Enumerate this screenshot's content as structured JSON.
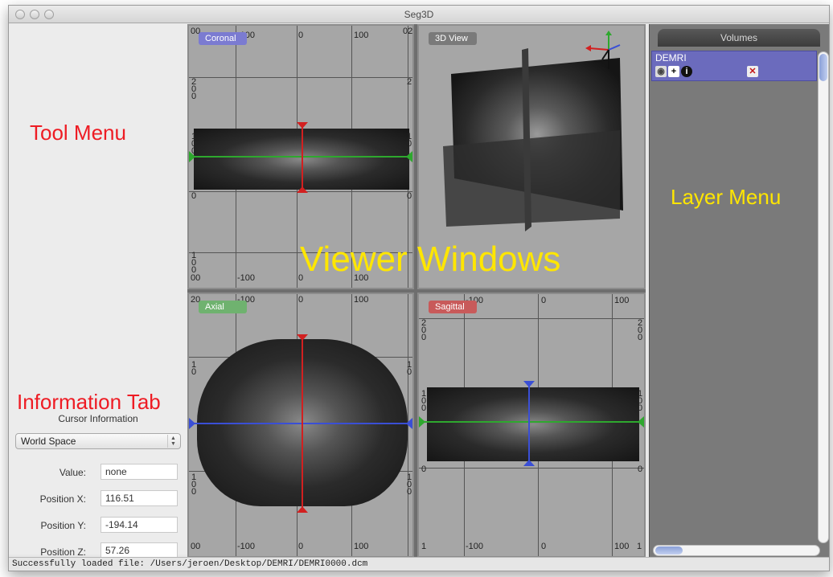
{
  "window": {
    "title": "Seg3D"
  },
  "annotations": {
    "tool_menu": "Tool Menu",
    "information_tab": "Information Tab",
    "layer_menu": "Layer Menu",
    "viewer_windows": "Viewer Windows"
  },
  "cursor_info": {
    "title": "Cursor Information",
    "space": "World Space",
    "fields": [
      {
        "label": "Value:",
        "value": "none"
      },
      {
        "label": "Position X:",
        "value": "116.51"
      },
      {
        "label": "Position Y:",
        "value": "-194.14"
      },
      {
        "label": "Position Z:",
        "value": "57.26"
      }
    ]
  },
  "viewers": {
    "coronal": {
      "label": "Coronal",
      "ticks_top": [
        "00",
        "-100",
        "0",
        "100",
        "02"
      ],
      "ticks_bottom": [
        "00",
        "-100",
        "0",
        "100"
      ],
      "ticks_left": [
        "200",
        "100",
        "0",
        "100"
      ],
      "ticks_right": [
        "2",
        "10",
        "0"
      ]
    },
    "view3d": {
      "label": "3D View"
    },
    "axial": {
      "label": "Axial",
      "ticks_top": [
        "20",
        "-100",
        "0",
        "100"
      ],
      "ticks_bottom": [
        "00",
        "-100",
        "0",
        "100"
      ],
      "ticks_left": [
        "10",
        "100"
      ],
      "ticks_right": [
        "10",
        "100"
      ]
    },
    "sagittal": {
      "label": "Sagittal",
      "ticks_top": [
        "-100",
        "0",
        "100"
      ],
      "ticks_bottom": [
        "1",
        "-100",
        "0",
        "100",
        "1"
      ],
      "ticks_left": [
        "200",
        "100",
        "0"
      ],
      "ticks_right": [
        "200",
        "100",
        "0"
      ]
    }
  },
  "colors": {
    "coronal_label": "#7b7bd1",
    "view3d_label": "#7a7a7a",
    "axial_label": "#6fb26f",
    "sagittal_label": "#c85a5a",
    "red_line": "#d22020",
    "green_line": "#2ea82e",
    "blue_line": "#3a4fd6"
  },
  "layers": {
    "tab": "Volumes",
    "items": [
      {
        "name": "DEMRI",
        "icons": [
          "eye-icon",
          "plus-icon",
          "info-icon",
          "delete-icon"
        ]
      }
    ]
  },
  "status": {
    "message": "Successfully loaded file: /Users/jeroen/Desktop/DEMRI/DEMRI0000.dcm"
  }
}
